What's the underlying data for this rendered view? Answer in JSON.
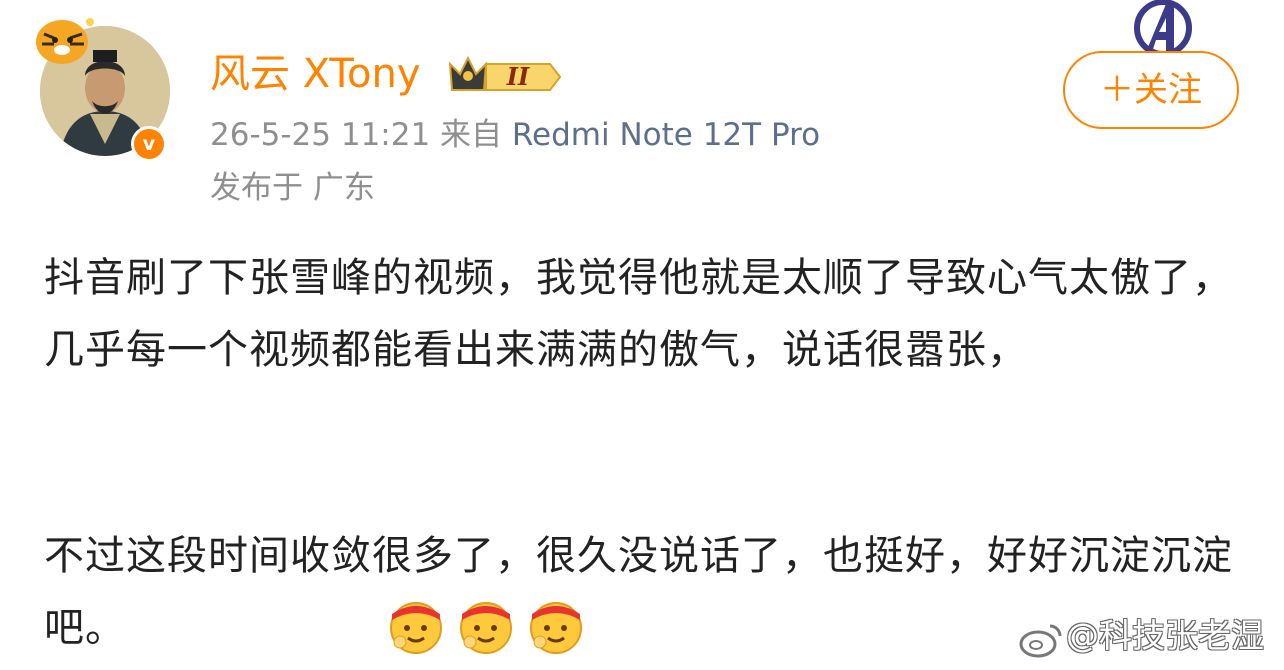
{
  "post": {
    "username": "风云 XTony",
    "rank_badge": "II",
    "time": "26-5-25 11:21",
    "source_prefix": "来自",
    "device": "Redmi Note 12T Pro",
    "location": "发布于 广东",
    "verified_mark": "v",
    "follow_label": "＋关注",
    "paragraph_1": "抖音刷了下张雪峰的视频，我觉得他就是太顺了导致心气太傲了，几乎每一个视频都能看出来满满的傲气，说话很嚣张，",
    "paragraph_2": "不过这段时间收敛很多了，很久没说话了，也挺好，好好沉淀沉淀吧。",
    "emoji_names": [
      "fighting-emoji",
      "fighting-emoji",
      "fighting-emoji"
    ]
  },
  "watermark": {
    "text": "@科技张老湿"
  },
  "colors": {
    "accent": "#ff8200",
    "device_link": "#5c6f8c",
    "meta": "#8f8f8f",
    "text": "#222222"
  }
}
